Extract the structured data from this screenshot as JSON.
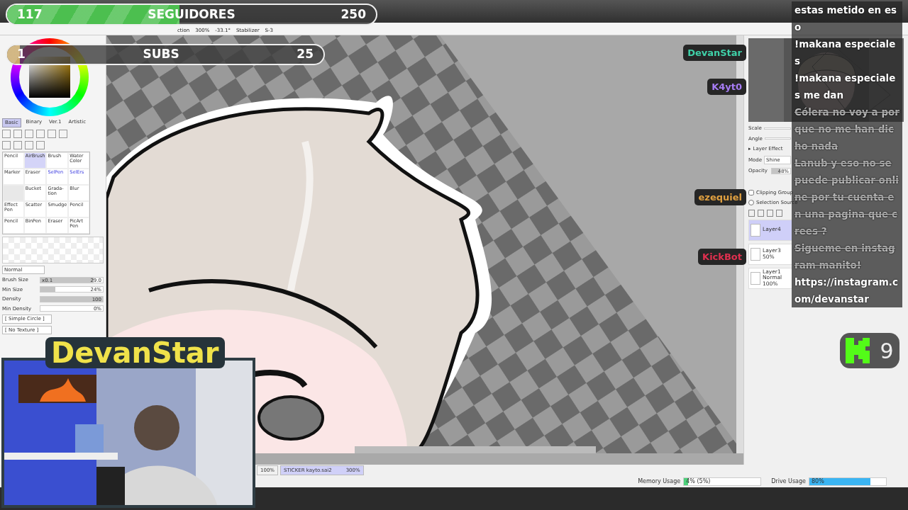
{
  "goals": [
    {
      "label": "SEGUIDORES",
      "current": "117",
      "target": "250",
      "level": 0.468,
      "color": "#4cbf4f"
    },
    {
      "label": "SUBS",
      "current": "1",
      "target": "25",
      "level": 0.04,
      "color": "#c9a86a"
    }
  ],
  "toolbar": {
    "items": [
      "ction",
      "300%",
      "-33.1°",
      "Stabilizer",
      "S-3"
    ]
  },
  "color_tabs": [
    {
      "label": "Basic",
      "selected": true
    },
    {
      "label": "Binary",
      "selected": false
    },
    {
      "label": "Ver.1",
      "selected": false
    },
    {
      "label": "Artistic",
      "selected": false
    }
  ],
  "tools": [
    {
      "kind": "tool",
      "name": "Pencil",
      "selected": false
    },
    {
      "kind": "tool",
      "name": "AirBrush",
      "selected": true
    },
    {
      "kind": "tool",
      "name": "Brush",
      "selected": false
    },
    {
      "kind": "tool",
      "name": "Water Color",
      "selected": false
    },
    {
      "kind": "tool",
      "name": "Marker",
      "selected": false
    },
    {
      "kind": "tool",
      "name": "Eraser",
      "selected": false
    },
    {
      "kind": "selection",
      "name": "SelPen",
      "selected": false
    },
    {
      "kind": "selection",
      "name": "SelErs",
      "selected": false
    },
    {
      "kind": "blank"
    },
    {
      "kind": "tool",
      "name": "Bucket",
      "selected": false
    },
    {
      "kind": "tool",
      "name": "Grada-tion",
      "selected": false
    },
    {
      "kind": "tool",
      "name": "Blur",
      "selected": false
    },
    {
      "kind": "tool",
      "name": "Effect Pen",
      "selected": false
    },
    {
      "kind": "tool",
      "name": "Scatter",
      "selected": false
    },
    {
      "kind": "tool",
      "name": "Smudge",
      "selected": false
    },
    {
      "kind": "tool",
      "name": "Pencil",
      "selected": false
    },
    {
      "kind": "tool",
      "name": "Pencil",
      "selected": false
    },
    {
      "kind": "tool",
      "name": "BinPen",
      "selected": false
    },
    {
      "kind": "tool",
      "name": "Eraser",
      "selected": false
    },
    {
      "kind": "tool",
      "name": "PicArt Pen",
      "selected": false
    }
  ],
  "blend_mode": "Normal",
  "brush_settings": [
    {
      "label": "Brush Size",
      "prefix": "x0.1",
      "value": "29.0",
      "level": 0.85
    },
    {
      "label": "Min Size",
      "value": "24%",
      "level": 0.24
    },
    {
      "label": "Density",
      "value": "100",
      "level": 1
    },
    {
      "label": "Min Density",
      "value": "0%",
      "level": 0
    }
  ],
  "shape_options": [
    "[ Simple Circle ]",
    "[ No Texture ]"
  ],
  "webcam": {
    "title": "DevanStar"
  },
  "navigator": {
    "scale_label": "Scale",
    "angle_label": "Angle"
  },
  "layer_panel": {
    "section_toggle": "▸",
    "section": "Layer Effect",
    "mode_label": "Mode",
    "mode": "Shine",
    "opacity_label": "Opacity",
    "opacity": "48%",
    "level": 0.48,
    "clipping_label": "Clipping Group",
    "clipping": false,
    "source_label": "Selection Source",
    "source": false
  },
  "layers": [
    {
      "name": "Layer4",
      "selected": true
    },
    {
      "name": "Layer3",
      "selected": false,
      "details": [
        "50%"
      ]
    },
    {
      "name": "Layer1",
      "selected": false,
      "details": [
        "Normal",
        "100%"
      ]
    }
  ],
  "chat": [
    {
      "text": "estas metido en eso",
      "deleted": false
    },
    {
      "user": "DevanStar",
      "color": "#3fd0a8",
      "text": "!makana especiales",
      "deleted": false
    },
    {
      "user": "K4yt0",
      "color": "#a77cf5",
      "text": "!makana especiales me dan",
      "deleted": false
    },
    {
      "text": "Cólera no voy a porque no me han dicho nada",
      "deleted": true
    },
    {
      "user": "ezequiel",
      "color": "#e0a040",
      "text": "Lanub y eso no se puede publicar online por tu cuenta en una pagina que crees ?",
      "deleted": true
    },
    {
      "user": "KickBot",
      "color": "#e0304f",
      "text": "Sigueme en instagram manito!",
      "deleted": true
    },
    {
      "text": "https://instagram.com/devanstar",
      "deleted": false
    }
  ],
  "kick_badge": {
    "count": "9"
  },
  "doc_tabs": [
    {
      "zoom": "100%",
      "selected": false
    },
    {
      "name": "STICKER kayto.sai2",
      "zoom": "300%",
      "selected": true
    }
  ],
  "status_bar": [
    {
      "label": "Memory Usage",
      "value": "4% (5%)",
      "level": 0.05,
      "color": "#4cd07a"
    },
    {
      "label": "Drive Usage",
      "value": "80%",
      "level": 0.8,
      "color": "#3ab4f2"
    }
  ]
}
